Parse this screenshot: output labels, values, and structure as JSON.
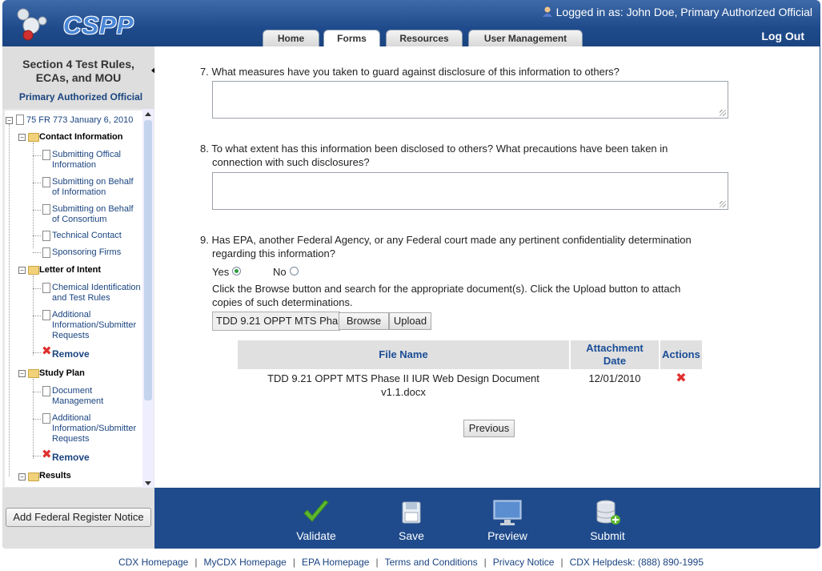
{
  "header": {
    "logo_text": "CSPP",
    "logged_in": "Logged in as: John Doe, Primary Authorized Official",
    "logout": "Log Out",
    "tabs": [
      "Home",
      "Forms",
      "Resources",
      "User Management"
    ],
    "active_tab": "Forms"
  },
  "sidebar": {
    "title_line1": "Section 4 Test Rules,",
    "title_line2": "ECAs, and MOU",
    "role": "Primary Authorized Official",
    "root": "75 FR 773 January 6, 2010",
    "groups": [
      {
        "label": "Contact Information",
        "items": [
          "Submitting Offical Information",
          "Submitting on Behalf of Information",
          "Submitting on Behalf of Consortium",
          "Technical Contact",
          "Sponsoring Firms"
        ]
      },
      {
        "label": "Letter of Intent",
        "items": [
          "Chemical Identification and Test Rules",
          "Additional Information/Submitter Requests"
        ],
        "remove": "Remove"
      },
      {
        "label": "Study Plan",
        "items": [
          "Document Management",
          "Additional Information/Submitter Requests"
        ],
        "remove": "Remove"
      },
      {
        "label": "Results",
        "items": []
      }
    ]
  },
  "main": {
    "q7": "7. What measures have you taken to guard against disclosure of this information to others?",
    "q8_line1": "8. To what extent has this information been disclosed to others? What precautions have been taken in",
    "q8_line2": "connection with such disclosures?",
    "q9_line1": "9. Has EPA, another Federal Agency, or any Federal court made any pertinent confidentiality determination",
    "q9_line2": "regarding this information?",
    "yes_label": "Yes",
    "no_label": "No",
    "selected": "Yes",
    "instructions_line1": "Click the Browse button and search for the appropriate document(s). Click the Upload button to attach",
    "instructions_line2": "copies of such determinations.",
    "file_value": "TDD 9.21 OPPT MTS Pha",
    "browse": "Browse",
    "upload": "Upload",
    "table": {
      "headers": {
        "file_name": "File Name",
        "attachment_date_line1": "Attachment",
        "attachment_date_line2": "Date",
        "actions": "Actions"
      },
      "rows": [
        {
          "file_name_line1": "TDD 9.21 OPPT MTS Phase II IUR Web Design Document",
          "file_name_line2": "v1.1.docx",
          "date": "12/01/2010"
        }
      ]
    },
    "previous": "Previous"
  },
  "bottom": {
    "add_notice": "Add Federal Register Notice",
    "actions": [
      "Validate",
      "Save",
      "Preview",
      "Submit"
    ]
  },
  "footer": {
    "links": [
      "CDX Homepage",
      "MyCDX Homepage",
      "EPA Homepage",
      "Terms and Conditions",
      "Privacy Notice",
      "CDX Helpdesk: (888) 890-1995"
    ]
  },
  "colors": {
    "brand_blue": "#1f4b8c",
    "link_blue": "#1a4480",
    "header_blue": "#1a4d96",
    "remove_red": "#e03030",
    "check_green": "#5cb82e"
  }
}
